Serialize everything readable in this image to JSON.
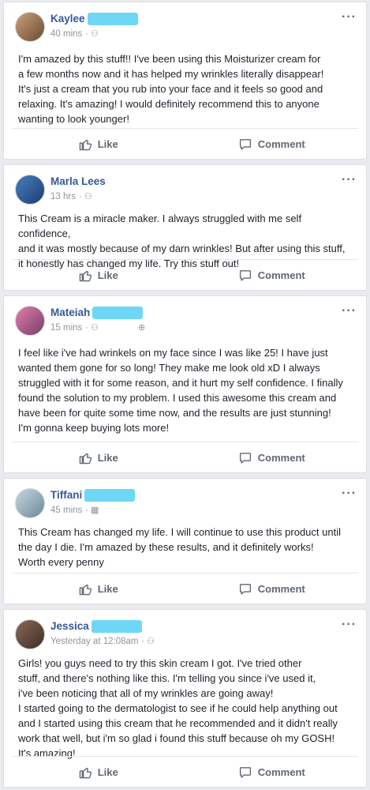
{
  "posts": [
    {
      "author": "Kaylee",
      "time": "40 mins",
      "audience_icon": "friends-icon",
      "text": "I'm amazed by this stuff!! I've been using this Moisturizer cream for\na few months now and it has helped my wrinkles literally disappear!\nIt's just a cream that you rub into your face and it feels so good and\nrelaxing. It's amazing! I would definitely recommend this to anyone\nwanting to look younger!",
      "like_label": "Like",
      "comment_label": "Comment"
    },
    {
      "author": "Marla Lees",
      "time": "13 hrs",
      "audience_icon": "friends-icon",
      "text": "This Cream is a miracle maker. I always struggled with me self confidence,\nand it was mostly because of my darn wrinkles! But after using this stuff,\nit honestly has changed my life. Try this stuff out!",
      "like_label": "Like",
      "comment_label": "Comment"
    },
    {
      "author": "Mateiah",
      "time": "15 mins",
      "audience_icon": "friends-icon",
      "text": "I feel like i've had wrinkels on my face since I was like 25! I have just\nwanted them gone for so long! They make me look old xD I always\nstruggled with it for some reason, and it hurt my self confidence. I finally\nfound the solution to my problem. I used this awesome this cream and\nhave been for quite some time now, and the results are just stunning!\nI'm gonna keep buying lots more!",
      "like_label": "Like",
      "comment_label": "Comment"
    },
    {
      "author": "Tiffani",
      "time": "45 mins",
      "audience_icon": "calendar-icon",
      "text": "This Cream has changed my life. I will continue to use this product until\nthe day I die. I'm amazed by these results, and it definitely works!\nWorth every penny",
      "like_label": "Like",
      "comment_label": "Comment"
    },
    {
      "author": "Jessica",
      "time": "Yesterday at 12:08am",
      "audience_icon": "friends-icon",
      "text": "Girls! you guys need to try this skin cream I got. I've tried other\nstuff, and there's nothing like this. I'm telling you since i've used it,\ni've been noticing that all of my wrinkles are going away!\nI started going to the dermatologist to see if he could help anything out\nand I started using this cream that he recommended and it didn't really\nwork that well, but i'm so glad i found this stuff because oh my GOSH!\nIt's amazing!",
      "like_label": "Like",
      "comment_label": "Comment"
    }
  ],
  "colors": {
    "name": "#365899",
    "meta": "#90949c",
    "redaction": "#5fd3f5",
    "action": "#606770"
  }
}
